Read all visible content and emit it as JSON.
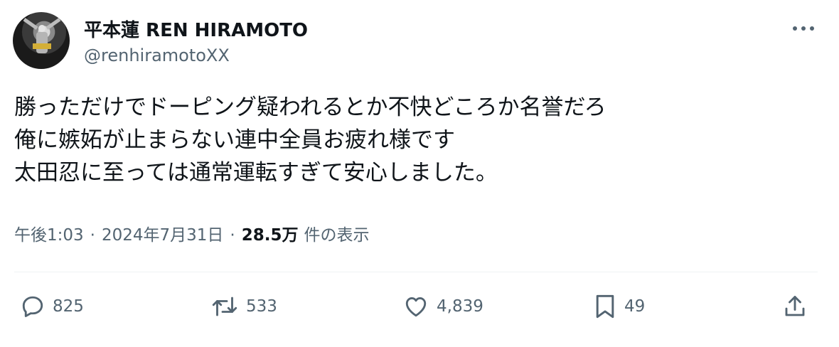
{
  "author": {
    "display_name": "平本蓮 REN HIRAMOTO",
    "handle": "@renhiramotoXX"
  },
  "tweet": {
    "lines": [
      "勝っただけでドーピング疑われるとか不快どころか名誉だろ",
      "俺に嫉妬が止まらない連中全員お疲れ様です",
      "太田忍に至っては通常運転すぎて安心しました。"
    ]
  },
  "meta": {
    "time": "午後1:03",
    "separator": "·",
    "date": "2024年7月31日",
    "views_count": "28.5万",
    "views_label": "件の表示"
  },
  "actions": {
    "reply_count": "825",
    "retweet_count": "533",
    "like_count": "4,839",
    "bookmark_count": "49"
  },
  "icons": {
    "more": "more-icon",
    "reply": "reply-icon",
    "retweet": "retweet-icon",
    "like": "heart-icon",
    "bookmark": "bookmark-icon",
    "share": "share-icon"
  },
  "colors": {
    "text_primary": "#0f1419",
    "text_secondary": "#536471",
    "divider": "#eff3f4"
  }
}
